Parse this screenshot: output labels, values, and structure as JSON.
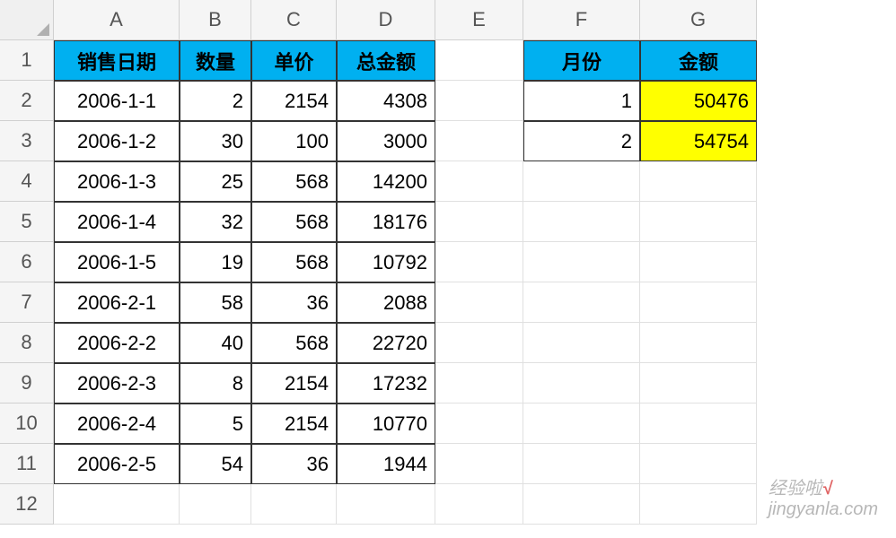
{
  "columns": [
    "A",
    "B",
    "C",
    "D",
    "E",
    "F",
    "G"
  ],
  "rows": [
    "1",
    "2",
    "3",
    "4",
    "5",
    "6",
    "7",
    "8",
    "9",
    "10",
    "11",
    "12"
  ],
  "headers_main": {
    "A": "销售日期",
    "B": "数量",
    "C": "单价",
    "D": "总金额"
  },
  "headers_side": {
    "F": "月份",
    "G": "金额"
  },
  "data_main": [
    {
      "A": "2006-1-1",
      "B": "2",
      "C": "2154",
      "D": "4308"
    },
    {
      "A": "2006-1-2",
      "B": "30",
      "C": "100",
      "D": "3000"
    },
    {
      "A": "2006-1-3",
      "B": "25",
      "C": "568",
      "D": "14200"
    },
    {
      "A": "2006-1-4",
      "B": "32",
      "C": "568",
      "D": "18176"
    },
    {
      "A": "2006-1-5",
      "B": "19",
      "C": "568",
      "D": "10792"
    },
    {
      "A": "2006-2-1",
      "B": "58",
      "C": "36",
      "D": "2088"
    },
    {
      "A": "2006-2-2",
      "B": "40",
      "C": "568",
      "D": "22720"
    },
    {
      "A": "2006-2-3",
      "B": "8",
      "C": "2154",
      "D": "17232"
    },
    {
      "A": "2006-2-4",
      "B": "5",
      "C": "2154",
      "D": "10770"
    },
    {
      "A": "2006-2-5",
      "B": "54",
      "C": "36",
      "D": "1944"
    }
  ],
  "data_side": [
    {
      "F": "1",
      "G": "50476"
    },
    {
      "F": "2",
      "G": "54754"
    }
  ],
  "watermark": {
    "text1": "经验啦",
    "text2": "√",
    "text3": "jingyanla.com"
  }
}
